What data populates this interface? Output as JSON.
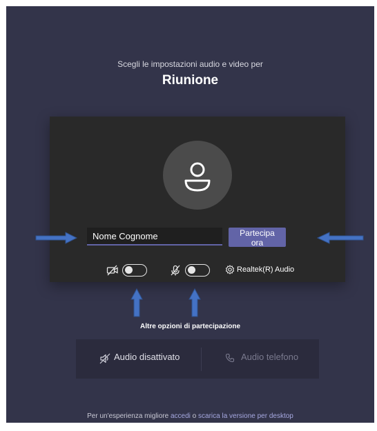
{
  "header": {
    "subtitle": "Scegli le impostazioni audio e video per",
    "title": "Riunione"
  },
  "prejoin": {
    "name_value": "Nome Cognome",
    "join_label": "Partecipa ora",
    "video_toggle_on": false,
    "mic_toggle_on": false,
    "device_label": "Realtek(R) Audio"
  },
  "annotations": {
    "more_options_label": "Altre opzioni di partecipazione",
    "arrow_color": "#4472c4"
  },
  "audio_options": {
    "off_label": "Audio disattivato",
    "phone_label": "Audio telefono"
  },
  "footer": {
    "prefix": "Per un'esperienza migliore",
    "signin_link": "accedi",
    "connector": "o",
    "download_link": "scarica la versione per desktop"
  },
  "colors": {
    "background": "#33344a",
    "panel": "#292929",
    "accent": "#6264a7"
  }
}
